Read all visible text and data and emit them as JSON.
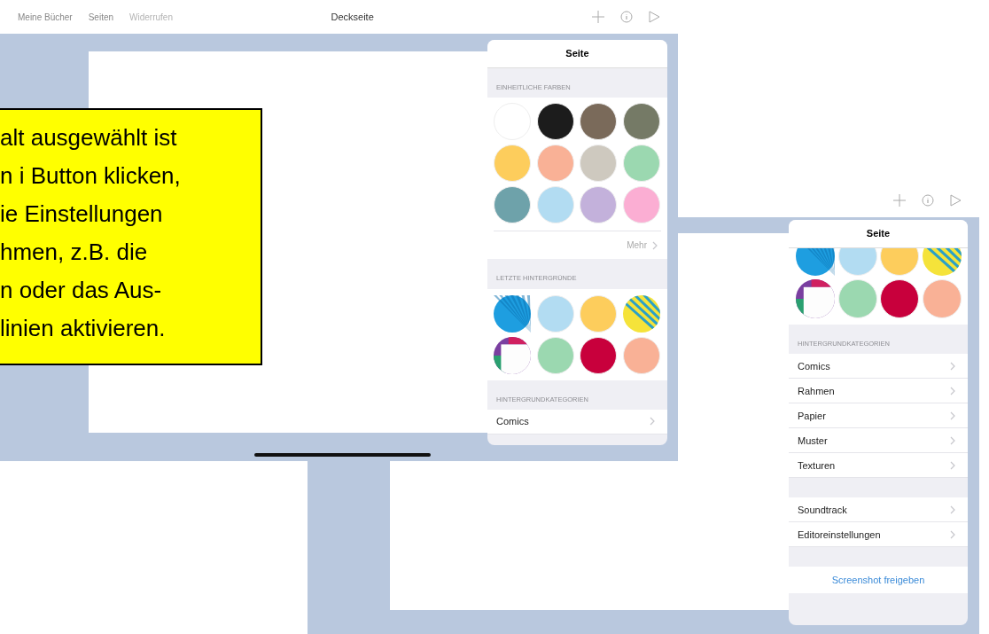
{
  "screen_main": {
    "toolbar": {
      "nav": [
        {
          "label": "Meine Bücher",
          "disabled": false
        },
        {
          "label": "Seiten",
          "disabled": false
        },
        {
          "label": "Widerrufen",
          "disabled": true
        }
      ],
      "title": "Deckseite"
    },
    "popover": {
      "title": "Seite",
      "solid_header": "EINHEITLICHE FARBEN",
      "solid_colors": [
        {
          "kind": "solid",
          "color": "#ffffff"
        },
        {
          "kind": "solid",
          "color": "#1c1c1c"
        },
        {
          "kind": "solid",
          "color": "#7a6a5a"
        },
        {
          "kind": "solid",
          "color": "#757a66"
        },
        {
          "kind": "solid",
          "color": "#fdcd5c"
        },
        {
          "kind": "solid",
          "color": "#f9b196"
        },
        {
          "kind": "solid",
          "color": "#cec9bf"
        },
        {
          "kind": "solid",
          "color": "#9bd8b0"
        },
        {
          "kind": "solid",
          "color": "#6ea2aa"
        },
        {
          "kind": "solid",
          "color": "#b2dcf2"
        },
        {
          "kind": "solid",
          "color": "#c3b1db"
        },
        {
          "kind": "solid",
          "color": "#fbaed3"
        }
      ],
      "more": "Mehr",
      "recent_header": "LETZTE HINTERGRÜNDE",
      "recent": [
        {
          "kind": "rays",
          "color": "#1e9ee0"
        },
        {
          "kind": "solid",
          "color": "#b2dcf2"
        },
        {
          "kind": "solid",
          "color": "#fdcd5c"
        },
        {
          "kind": "comic",
          "color": "#f5e33a"
        },
        {
          "kind": "frame"
        },
        {
          "kind": "solid",
          "color": "#9bd8b0"
        },
        {
          "kind": "solid",
          "color": "#c8003c"
        },
        {
          "kind": "solid",
          "color": "#f9b196"
        }
      ],
      "categories_header": "HINTERGRUNDKATEGORIEN",
      "categories": [
        "Comics"
      ]
    }
  },
  "callout": {
    "lines": [
      "alt ausgewählt ist",
      "n i Button klicken,",
      "ie Einstellungen",
      "hmen, z.B. die",
      "n oder das Aus-",
      "linien aktivieren."
    ]
  },
  "screen_second": {
    "popover": {
      "title": "Seite",
      "recent": [
        {
          "kind": "rays",
          "color": "#1e9ee0"
        },
        {
          "kind": "solid",
          "color": "#b2dcf2"
        },
        {
          "kind": "solid",
          "color": "#fdcd5c"
        },
        {
          "kind": "comic",
          "color": "#f5e33a"
        },
        {
          "kind": "frame"
        },
        {
          "kind": "solid",
          "color": "#9bd8b0"
        },
        {
          "kind": "solid",
          "color": "#c8003c"
        },
        {
          "kind": "solid",
          "color": "#f9b196"
        }
      ],
      "categories_header": "HINTERGRUNDKATEGORIEN",
      "categories": [
        "Comics",
        "Rahmen",
        "Papier",
        "Muster",
        "Texturen"
      ],
      "settings": [
        "Soundtrack",
        "Editoreinstellungen"
      ],
      "share": "Screenshot freigeben"
    }
  }
}
